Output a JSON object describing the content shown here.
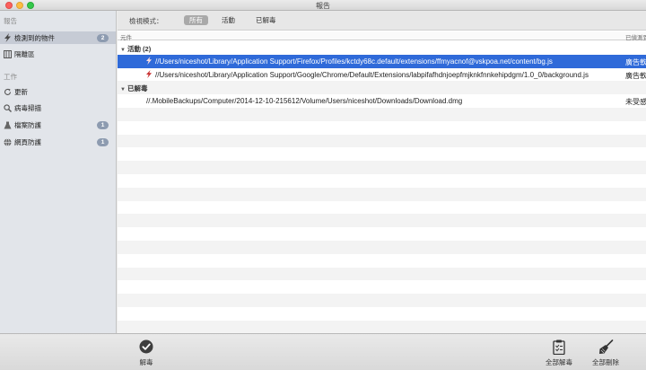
{
  "window": {
    "title": "報告"
  },
  "sidebar": {
    "report_section": "報告",
    "report_items": [
      {
        "label": "檢測到的物件",
        "badge": "2",
        "icon": "lightning-icon"
      },
      {
        "label": "隔離區",
        "badge": "",
        "icon": "quarantine-icon"
      }
    ],
    "work_section": "工作",
    "work_items": [
      {
        "label": "更新",
        "badge": "",
        "icon": "refresh-icon"
      },
      {
        "label": "病毒掃描",
        "badge": "",
        "icon": "magnifier-icon"
      },
      {
        "label": "檔案防護",
        "badge": "1",
        "icon": "flask-icon"
      },
      {
        "label": "網頁防護",
        "badge": "1",
        "icon": "globe-icon"
      }
    ]
  },
  "filter": {
    "label": "檢視模式：",
    "options": [
      "所有",
      "活動",
      "已解毒"
    ],
    "active": "所有"
  },
  "table": {
    "col_object": "元件",
    "col_status": "已偵測到",
    "groups": [
      {
        "label": "活動 (2)",
        "items": [
          {
            "path": "//Users/niceshot/Library/Application Support/Firefox/Profiles/kctdy68c.default/extensions/ffmyacnof@vskpoa.net/content/bg.js",
            "status": "廣告軟體",
            "selected": true
          },
          {
            "path": "//Users/niceshot/Library/Application Support/Google/Chrome/Default/Extensions/labpifafhdnjoepfmjknkfnnkehipdgm/1.0_0/background.js",
            "status": "廣告軟體",
            "selected": false
          }
        ]
      },
      {
        "label": "已解毒",
        "items": [
          {
            "path": "//.MobileBackups/Computer/2014-12-10-215612/Volume/Users/niceshot/Downloads/Download.dmg",
            "status": "未受感染",
            "selected": false
          }
        ]
      }
    ]
  },
  "toolbar": {
    "disinfect_label": "解毒",
    "disinfect_all_label": "全部解毒",
    "delete_all_label": "全部刪除"
  },
  "colors": {
    "selection": "#2f6ad9",
    "badge": "#8d9bb0",
    "threat_icon": "#c93030"
  }
}
